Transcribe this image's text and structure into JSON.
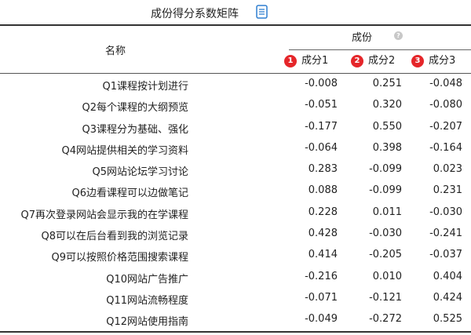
{
  "title": "成份得分系数矩阵",
  "icons": {
    "copy": "copy-document-icon",
    "help": "help-circle-icon"
  },
  "header": {
    "name_col": "名称",
    "group_label": "成份",
    "columns": [
      {
        "badge": "1",
        "label": "成分1"
      },
      {
        "badge": "2",
        "label": "成分2"
      },
      {
        "badge": "3",
        "label": "成分3"
      }
    ]
  },
  "colors": {
    "badge": "#e5262a",
    "icon": "#2f7fd0"
  },
  "rows": [
    {
      "name": "Q1课程按计划进行",
      "values": [
        "-0.008",
        "0.251",
        "-0.048"
      ]
    },
    {
      "name": "Q2每个课程的大纲预览",
      "values": [
        "-0.051",
        "0.320",
        "-0.080"
      ]
    },
    {
      "name": "Q3课程分为基础、强化",
      "values": [
        "-0.177",
        "0.550",
        "-0.207"
      ]
    },
    {
      "name": "Q4网站提供相关的学习资料",
      "values": [
        "-0.064",
        "0.398",
        "-0.164"
      ]
    },
    {
      "name": "Q5网站论坛学习讨论",
      "values": [
        "0.283",
        "-0.099",
        "0.023"
      ]
    },
    {
      "name": "Q6边看课程可以边做笔记",
      "values": [
        "0.088",
        "-0.099",
        "0.231"
      ]
    },
    {
      "name": "Q7再次登录网站会显示我的在学课程",
      "values": [
        "0.228",
        "0.011",
        "-0.030"
      ]
    },
    {
      "name": "Q8可以在后台看到我的浏览记录",
      "values": [
        "0.428",
        "-0.030",
        "-0.241"
      ]
    },
    {
      "name": "Q9可以按照价格范围搜索课程",
      "values": [
        "0.414",
        "-0.205",
        "-0.037"
      ]
    },
    {
      "name": "Q10网站广告推广",
      "values": [
        "-0.216",
        "0.010",
        "0.404"
      ]
    },
    {
      "name": "Q11网站流畅程度",
      "values": [
        "-0.071",
        "-0.121",
        "0.424"
      ]
    },
    {
      "name": "Q12网站使用指南",
      "values": [
        "-0.049",
        "-0.272",
        "0.525"
      ]
    }
  ]
}
